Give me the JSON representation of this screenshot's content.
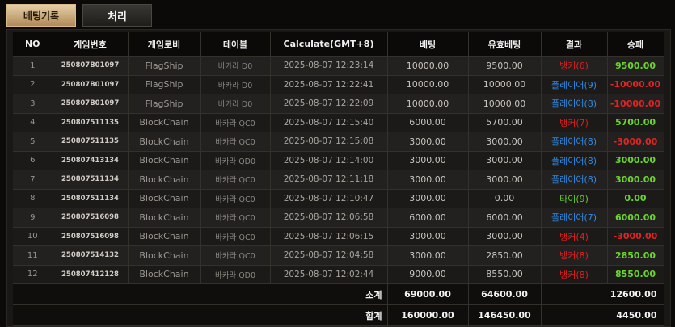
{
  "tabs": {
    "betting_history": "베팅기록",
    "processing": "처리"
  },
  "columns": [
    "NO",
    "게임번호",
    "게임로비",
    "테이블",
    "Calculate(GMT+8)",
    "베팅",
    "유효베팅",
    "결과",
    "승패"
  ],
  "rows": [
    {
      "no": "1",
      "game_id": "250807B01097",
      "lobby": "FlagShip",
      "table": "바카라 D0",
      "time": "2025-08-07 12:23:14",
      "bet": "10000.00",
      "valid": "9500.00",
      "result": "뱅커(6)",
      "result_type": "banker",
      "winloss": "9500.00",
      "wl_type": "pos"
    },
    {
      "no": "2",
      "game_id": "250807B01097",
      "lobby": "FlagShip",
      "table": "바카라 D0",
      "time": "2025-08-07 12:22:41",
      "bet": "10000.00",
      "valid": "10000.00",
      "result": "플레이어(9)",
      "result_type": "player",
      "winloss": "-10000.00",
      "wl_type": "neg"
    },
    {
      "no": "3",
      "game_id": "250807B01097",
      "lobby": "FlagShip",
      "table": "바카라 D0",
      "time": "2025-08-07 12:22:09",
      "bet": "10000.00",
      "valid": "10000.00",
      "result": "플레이어(8)",
      "result_type": "player",
      "winloss": "-10000.00",
      "wl_type": "neg"
    },
    {
      "no": "4",
      "game_id": "250807511135",
      "lobby": "BlockChain",
      "table": "바카라 QC0",
      "time": "2025-08-07 12:15:40",
      "bet": "6000.00",
      "valid": "5700.00",
      "result": "뱅커(7)",
      "result_type": "banker",
      "winloss": "5700.00",
      "wl_type": "pos"
    },
    {
      "no": "5",
      "game_id": "250807511135",
      "lobby": "BlockChain",
      "table": "바카라 QC0",
      "time": "2025-08-07 12:15:08",
      "bet": "3000.00",
      "valid": "3000.00",
      "result": "플레이어(8)",
      "result_type": "player",
      "winloss": "-3000.00",
      "wl_type": "neg"
    },
    {
      "no": "6",
      "game_id": "250807413134",
      "lobby": "BlockChain",
      "table": "바카라 QD0",
      "time": "2025-08-07 12:14:00",
      "bet": "3000.00",
      "valid": "3000.00",
      "result": "플레이어(8)",
      "result_type": "player",
      "winloss": "3000.00",
      "wl_type": "pos"
    },
    {
      "no": "7",
      "game_id": "250807511134",
      "lobby": "BlockChain",
      "table": "바카라 QC0",
      "time": "2025-08-07 12:11:18",
      "bet": "3000.00",
      "valid": "3000.00",
      "result": "플레이어(8)",
      "result_type": "player",
      "winloss": "3000.00",
      "wl_type": "pos"
    },
    {
      "no": "8",
      "game_id": "250807511134",
      "lobby": "BlockChain",
      "table": "바카라 QC0",
      "time": "2025-08-07 12:10:47",
      "bet": "3000.00",
      "valid": "0.00",
      "result": "타이(9)",
      "result_type": "tie",
      "winloss": "0.00",
      "wl_type": "pos"
    },
    {
      "no": "9",
      "game_id": "250807516098",
      "lobby": "BlockChain",
      "table": "바카라 QC0",
      "time": "2025-08-07 12:06:58",
      "bet": "6000.00",
      "valid": "6000.00",
      "result": "플레이어(7)",
      "result_type": "player",
      "winloss": "6000.00",
      "wl_type": "pos"
    },
    {
      "no": "10",
      "game_id": "250807516098",
      "lobby": "BlockChain",
      "table": "바카라 QC0",
      "time": "2025-08-07 12:06:15",
      "bet": "3000.00",
      "valid": "3000.00",
      "result": "뱅커(4)",
      "result_type": "banker",
      "winloss": "-3000.00",
      "wl_type": "neg"
    },
    {
      "no": "11",
      "game_id": "250807514132",
      "lobby": "BlockChain",
      "table": "바카라 QC0",
      "time": "2025-08-07 12:04:58",
      "bet": "3000.00",
      "valid": "2850.00",
      "result": "뱅커(8)",
      "result_type": "banker",
      "winloss": "2850.00",
      "wl_type": "pos"
    },
    {
      "no": "12",
      "game_id": "250807412128",
      "lobby": "BlockChain",
      "table": "바카라 QD0",
      "time": "2025-08-07 12:02:44",
      "bet": "9000.00",
      "valid": "8550.00",
      "result": "뱅커(8)",
      "result_type": "banker",
      "winloss": "8550.00",
      "wl_type": "pos"
    }
  ],
  "subtotal": {
    "label": "소계",
    "bet": "69000.00",
    "valid": "64600.00",
    "winloss": "12600.00"
  },
  "total": {
    "label": "합계",
    "bet": "160000.00",
    "valid": "146450.00",
    "winloss": "4450.00"
  },
  "colors": {
    "banker": "#e21f1f",
    "player": "#2f8ae6",
    "tie": "#66cc2b",
    "win": "#6ad62b",
    "loss": "#e02424",
    "accent": "#c9a26d"
  }
}
